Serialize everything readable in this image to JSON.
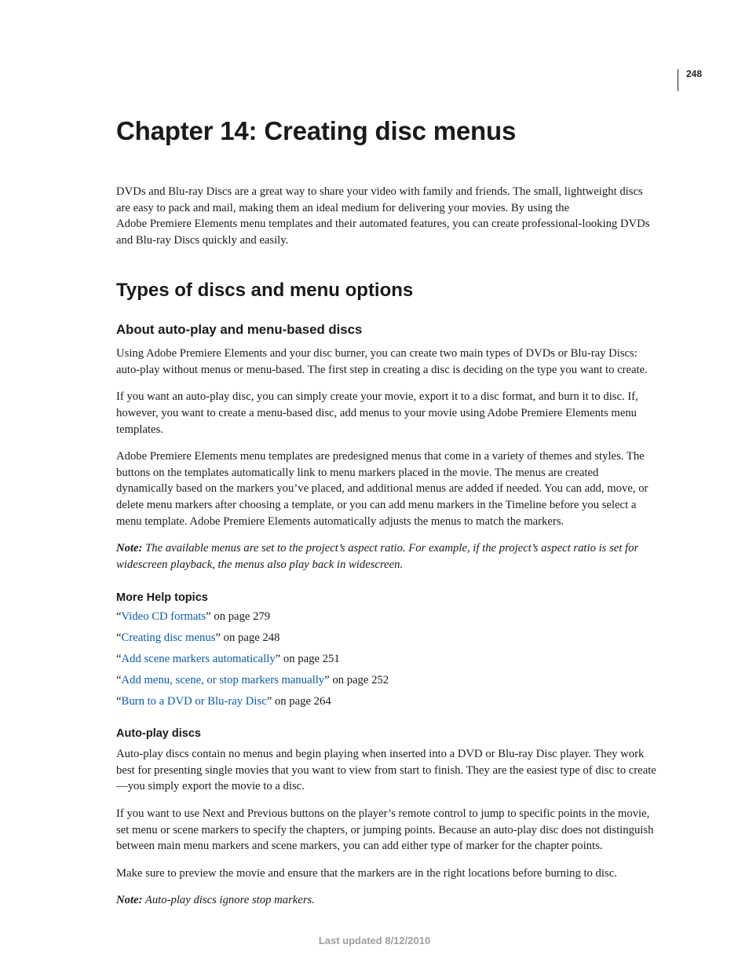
{
  "page_number": "248",
  "chapter_title": "Chapter 14: Creating disc menus",
  "intro": "DVDs and Blu-ray Discs are a great way to share your video with family and friends. The small, lightweight discs are easy to pack and mail, making them an ideal medium for delivering your movies. By using the Adobe Premiere Elements menu templates and their automated features, you can create professional-looking DVDs and Blu-ray Discs quickly and easily.",
  "section_title": "Types of discs and menu options",
  "sub1_title": "About auto-play and menu-based discs",
  "p1": "Using Adobe Premiere Elements and your disc burner, you can create two main types of DVDs or Blu-ray Discs: auto-play without menus or menu-based. The first step in creating a disc is deciding on the type you want to create.",
  "p2": "If you want an auto-play disc, you can simply create your movie, export it to a disc format, and burn it to disc. If, however, you want to create a menu-based disc, add menus to your movie using Adobe Premiere Elements menu templates.",
  "p3": "Adobe Premiere Elements menu templates are predesigned menus that come in a variety of themes and styles. The buttons on the templates automatically link to menu markers placed in the movie. The menus are created dynamically based on the markers you’ve placed, and additional menus are added if needed. You can add, move, or delete menu markers after choosing a template, or you can add menu markers in the Timeline before you select a menu template. Adobe Premiere Elements automatically adjusts the menus to match the markers.",
  "note1_label": "Note:",
  "note1_body": " The available menus are set to the project’s aspect ratio. For example, if the project’s aspect ratio is set for widescreen playback, the menus also play back in widescreen.",
  "more_help": "More Help topics",
  "refs": [
    {
      "pre": "“",
      "link": "Video CD formats",
      "post": "” on page 279"
    },
    {
      "pre": "“",
      "link": "Creating disc menus",
      "post": "” on page 248"
    },
    {
      "pre": "“",
      "link": "Add scene markers automatically",
      "post": "” on page 251"
    },
    {
      "pre": "“",
      "link": "Add menu, scene, or stop markers manually",
      "post": "” on page 252"
    },
    {
      "pre": "“",
      "link": "Burn to a DVD or Blu-ray Disc",
      "post": "” on page 264"
    }
  ],
  "sub2_title": "Auto-play discs",
  "p4": "Auto-play discs contain no menus and begin playing when inserted into a DVD or Blu-ray Disc player. They work best for presenting single movies that you want to view from start to finish. They are the easiest type of disc to create—you simply export the movie to a disc.",
  "p5": "If you want to use Next and Previous buttons on the player’s remote control to jump to specific points in the movie, set menu or scene markers to specify the chapters, or jumping points. Because an auto-play disc does not distinguish between main menu markers and scene markers, you can add either type of marker for the chapter points.",
  "p6": "Make sure to preview the movie and ensure that the markers are in the right locations before burning to disc.",
  "note2_label": "Note:",
  "note2_body": " Auto-play discs ignore stop markers.",
  "footer": "Last updated 8/12/2010"
}
